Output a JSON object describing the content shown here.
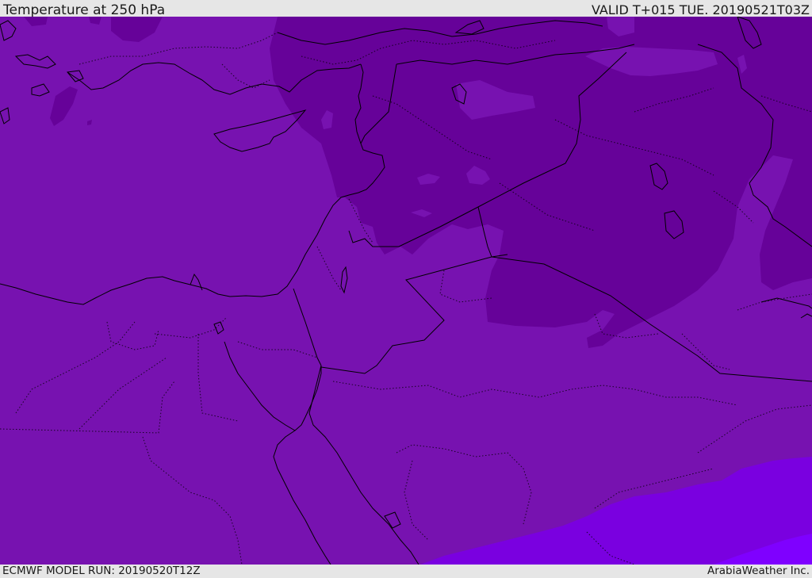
{
  "header": {
    "title": "Temperature at 250 hPa",
    "valid_time": "VALID T+015 TUE. 20190521T03Z"
  },
  "footer": {
    "model_run": "ECMWF MODEL RUN: 20190520T12Z",
    "credit": "ArabiaWeather Inc."
  },
  "colors": {
    "base_fill": "#7712b0",
    "cold_fill": "#660299",
    "warm_fill": "#7a00e0",
    "warmest_fill": "#7f00ff",
    "coastline": "#000000",
    "background": "#e6e6e6"
  }
}
